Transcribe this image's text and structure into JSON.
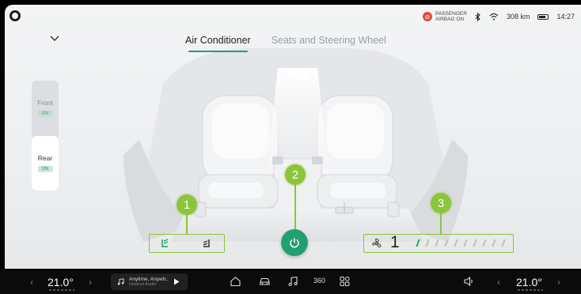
{
  "status": {
    "airbag_line1": "PASSENGER",
    "airbag_line2": "AIRBAG ON",
    "range": "308 km",
    "time": "14:27"
  },
  "tabs": [
    {
      "label": "Air Conditioner",
      "active": true
    },
    {
      "label": "Seats and Steering Wheel",
      "active": false
    }
  ],
  "zones": {
    "front": {
      "label": "Front",
      "badge": "ON"
    },
    "rear": {
      "label": "Rear",
      "badge": "ON"
    }
  },
  "callouts": [
    "1",
    "2",
    "3"
  ],
  "fan": {
    "level": "1",
    "max_level": 10
  },
  "dock": {
    "left_temp": "21.0°",
    "right_temp": "21.0°",
    "music_title": "Anytime, Anywh..",
    "music_source": "Desired Audio",
    "mode_360": "360"
  },
  "colors": {
    "accent": "#1e9e73",
    "callout": "#8cc43b",
    "power": "#22a06f"
  }
}
